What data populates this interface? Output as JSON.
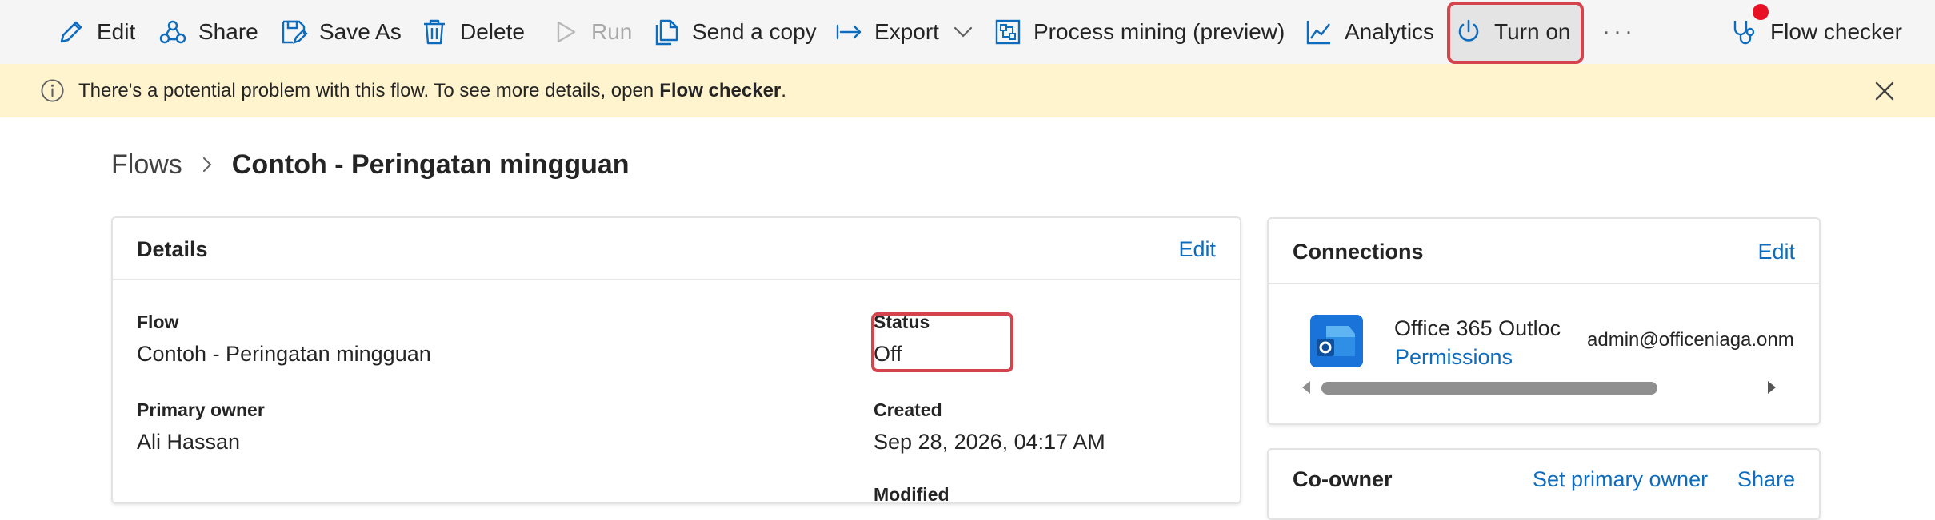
{
  "toolbar": {
    "edit": "Edit",
    "share": "Share",
    "save_as": "Save As",
    "delete": "Delete",
    "run": "Run",
    "send_copy": "Send a copy",
    "export": "Export",
    "process_mining": "Process mining (preview)",
    "analytics": "Analytics",
    "turn_on": "Turn on",
    "more": "···",
    "flow_checker": "Flow checker"
  },
  "banner": {
    "message": "There's a potential problem with this flow. To see more details, open",
    "link": "Flow checker",
    "period": "."
  },
  "breadcrumb": {
    "root": "Flows",
    "current": "Contoh - Peringatan mingguan"
  },
  "details": {
    "title": "Details",
    "edit": "Edit",
    "flow_label": "Flow",
    "flow_value": "Contoh - Peringatan mingguan",
    "status_label": "Status",
    "status_value": "Off",
    "owner_label": "Primary owner",
    "owner_value": "Ali Hassan",
    "created_label": "Created",
    "created_value": "Sep 28, 2026, 04:17 AM",
    "modified_label": "Modified"
  },
  "connections": {
    "title": "Connections",
    "edit": "Edit",
    "name": "Office 365 Outloc",
    "permissions": "Permissions",
    "account": "admin@officeniaga.onm"
  },
  "coowner": {
    "title": "Co-owner",
    "set_primary": "Set primary owner",
    "share": "Share"
  },
  "colors": {
    "accent": "#0f6cbd",
    "highlight": "#d4444c",
    "banner_bg": "#fff4ce",
    "notification_dot": "#e81123"
  }
}
